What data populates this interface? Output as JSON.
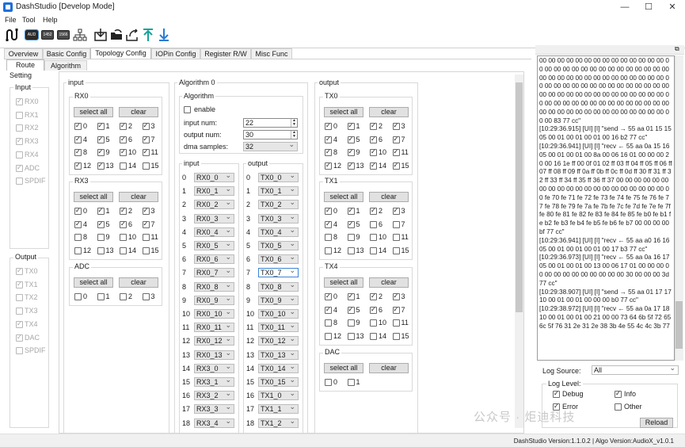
{
  "window": {
    "title": "DashStudio [Develop Mode]",
    "minimize": "—",
    "maximize": "☐",
    "close": "✕"
  },
  "menu": [
    "File",
    "Tool",
    "Help"
  ],
  "toolbar": {
    "chip1": "AUD",
    "chip2": "1452",
    "chip3": "1566"
  },
  "tabs": [
    "Overview",
    "Basic Config",
    "Topology Config",
    "IOPin Config",
    "Register R/W",
    "Misc Func"
  ],
  "subtabs": [
    "Route",
    "Algorithm"
  ],
  "setting": {
    "title": "Setting",
    "input_title": "Input",
    "inputs": [
      {
        "label": "RX0",
        "checked": true
      },
      {
        "label": "RX1",
        "checked": false
      },
      {
        "label": "RX2",
        "checked": false
      },
      {
        "label": "RX3",
        "checked": true
      },
      {
        "label": "RX4",
        "checked": false
      },
      {
        "label": "ADC",
        "checked": true
      },
      {
        "label": "SPDIF",
        "checked": false
      }
    ],
    "output_title": "Output",
    "outputs": [
      {
        "label": "TX0",
        "checked": true
      },
      {
        "label": "TX1",
        "checked": true
      },
      {
        "label": "TX2",
        "checked": false
      },
      {
        "label": "TX3",
        "checked": false
      },
      {
        "label": "TX4",
        "checked": true
      },
      {
        "label": "DAC",
        "checked": true
      },
      {
        "label": "SPDIF",
        "checked": false
      }
    ]
  },
  "input_panel": {
    "title": "input",
    "select_all": "select all",
    "clear": "clear",
    "groups": [
      {
        "name": "RX0",
        "channels": [
          "0",
          "1",
          "2",
          "3",
          "4",
          "5",
          "6",
          "7",
          "8",
          "9",
          "10",
          "11",
          "12",
          "13",
          "14",
          "15"
        ],
        "checked": [
          true,
          true,
          true,
          true,
          true,
          true,
          true,
          true,
          true,
          true,
          true,
          true,
          true,
          true,
          false,
          false
        ]
      },
      {
        "name": "RX3",
        "channels": [
          "0",
          "1",
          "2",
          "3",
          "4",
          "5",
          "6",
          "7",
          "8",
          "9",
          "10",
          "11",
          "12",
          "13",
          "14",
          "15"
        ],
        "checked": [
          true,
          true,
          true,
          true,
          true,
          true,
          true,
          true,
          false,
          false,
          false,
          false,
          false,
          false,
          false,
          false
        ]
      },
      {
        "name": "ADC",
        "channels": [
          "0",
          "1",
          "2",
          "3"
        ],
        "checked": [
          false,
          false,
          false,
          false
        ]
      }
    ]
  },
  "algorithm": {
    "title": "Algorithm 0",
    "sub_title": "Algorithm",
    "enable_label": "enable",
    "enable": false,
    "input_num_label": "input num:",
    "input_num": "22",
    "output_num_label": "output num:",
    "output_num": "30",
    "dma_label": "dma samples:",
    "dma_samples": "32",
    "input_col": "input",
    "output_col": "output",
    "rows": [
      {
        "idx": "0",
        "in": "RX0_0",
        "out": "TX0_0"
      },
      {
        "idx": "1",
        "in": "RX0_1",
        "out": "TX0_1"
      },
      {
        "idx": "2",
        "in": "RX0_2",
        "out": "TX0_2"
      },
      {
        "idx": "3",
        "in": "RX0_3",
        "out": "TX0_3"
      },
      {
        "idx": "4",
        "in": "RX0_4",
        "out": "TX0_4"
      },
      {
        "idx": "5",
        "in": "RX0_5",
        "out": "TX0_5"
      },
      {
        "idx": "6",
        "in": "RX0_6",
        "out": "TX0_6"
      },
      {
        "idx": "7",
        "in": "RX0_7",
        "out": "TX0_7"
      },
      {
        "idx": "8",
        "in": "RX0_8",
        "out": "TX0_8"
      },
      {
        "idx": "9",
        "in": "RX0_9",
        "out": "TX0_9"
      },
      {
        "idx": "10",
        "in": "RX0_10",
        "out": "TX0_10"
      },
      {
        "idx": "11",
        "in": "RX0_11",
        "out": "TX0_11"
      },
      {
        "idx": "12",
        "in": "RX0_12",
        "out": "TX0_12"
      },
      {
        "idx": "13",
        "in": "RX0_13",
        "out": "TX0_13"
      },
      {
        "idx": "14",
        "in": "RX3_0",
        "out": "TX0_14"
      },
      {
        "idx": "15",
        "in": "RX3_1",
        "out": "TX0_15"
      },
      {
        "idx": "16",
        "in": "RX3_2",
        "out": "TX1_0"
      },
      {
        "idx": "17",
        "in": "RX3_3",
        "out": "TX1_1"
      },
      {
        "idx": "18",
        "in": "RX3_4",
        "out": "TX1_2"
      }
    ]
  },
  "output_panel": {
    "title": "output",
    "select_all": "select all",
    "clear": "clear",
    "groups": [
      {
        "name": "TX0",
        "channels": [
          "0",
          "1",
          "2",
          "3",
          "4",
          "5",
          "6",
          "7",
          "8",
          "9",
          "10",
          "11",
          "12",
          "13",
          "14",
          "15"
        ],
        "checked": [
          true,
          true,
          true,
          true,
          true,
          true,
          true,
          true,
          true,
          true,
          true,
          true,
          true,
          true,
          true,
          true
        ]
      },
      {
        "name": "TX1",
        "channels": [
          "0",
          "1",
          "2",
          "3",
          "4",
          "5",
          "6",
          "7",
          "8",
          "9",
          "10",
          "11",
          "12",
          "13",
          "14",
          "15"
        ],
        "checked": [
          true,
          true,
          true,
          true,
          true,
          true,
          false,
          false,
          false,
          false,
          false,
          false,
          false,
          false,
          false,
          false
        ]
      },
      {
        "name": "TX4",
        "channels": [
          "0",
          "1",
          "2",
          "3",
          "4",
          "5",
          "6",
          "7",
          "8",
          "9",
          "10",
          "11",
          "12",
          "13",
          "14",
          "15"
        ],
        "checked": [
          true,
          true,
          true,
          true,
          true,
          true,
          true,
          true,
          false,
          false,
          false,
          false,
          false,
          false,
          false,
          false
        ]
      },
      {
        "name": "DAC",
        "channels": [
          "0",
          "1"
        ],
        "checked": [
          false,
          false
        ]
      }
    ]
  },
  "log": {
    "lines": [
      "00 00 00 00 00 00 00 00 00 00 00 00 00 00 00 00 00 00 00 00 00 00 00 00 00 00 00 00 00 00 00 00 00 00 00 00 00 00 00 00 00 00 00 00 00 00 00 00 00 00 00 00 00 00 00 00 00 00 00 00 00 00 00 00 00 00 00 00 00 00 00 00 00 00 00 00 00 00 00 00 00 00 00 00 00 00 00 00 00 00 00 00 00 00 00 00 00 00 00 00 00 00 00 83 77 cc\"",
      "[10:29:36.915] [UI] [I] \"send → 55 aa 01 15 15 05 00 01 00 01 00 01 00 16 b2 77 cc\"",
      "[10:29:36.941] [UI] [I] \"recv ← 55 aa 0a 15 16 05 00 01 00 01 00 8a 00 06 16 01 00 00 00 20 00 16 1e ff 00 0f 01 02 ff 03 ff 04 ff 05 ff 06 ff 07 ff 08 ff 09 ff 0a ff 0b ff 0c ff 0d ff 30 ff 31 ff 32 ff 33 ff 34 ff 35 ff 36 ff 37 00 00 00 00 00 00 00 00 00 00 00 00 00 00 00 00 00 00 00 00 00 fe 70 fe 71 fe 72 fe 73 fe 74 fe 75 fe 76 fe 77 fe 78 fe 79 fe 7a fe 7b fe 7c fe 7d fe 7e fe 7f fe 80 fe 81 fe 82 fe 83 fe 84 fe 85 fe b0 fe b1 fe b2 fe b3 fe b4 fe b5 fe b6 fe b7 00 00 00 00 bf 77 cc\"",
      "[10:29:36.941] [UI] [I] \"recv ← 55 aa a0 16 16 05 00 01 00 01 00 01 00 17 b3 77 cc\"",
      "[10:29:36.973] [UI] [I] \"recv ← 55 aa 0a 16 17 05 00 01 00 01 00 13 00 06 17 01 00 00 00 00 00 00 00 00 00 00 00 00 00 30 00 00 00 3d 77 cc\"",
      "[10:29:38.907] [UI] [I] \"send → 55 aa 01 17 17 10 00 01 00 01 00 00 00 b0 77 cc\"",
      "[10:29:38.972] [UI] [I] \"recv ← 55 aa 0a 17 18 10 00 01 00 01 00 21 00 00 73 64 6b 5f 72 65 6c 5f 76 31 2e 31 2e 38 3b 4e 55 4c 4c 3b 77"
    ],
    "source_label": "Log Source:",
    "source_value": "All",
    "level_label": "Log Level:",
    "levels": [
      {
        "label": "Debug",
        "checked": true
      },
      {
        "label": "Info",
        "checked": true
      },
      {
        "label": "Error",
        "checked": true
      },
      {
        "label": "Other",
        "checked": false
      }
    ],
    "reload": "Reload"
  },
  "status": "DashStudio Version:1.1.0.2 | Algo Version:AudioX_v1.0.1",
  "watermark": "公众号 · 炬迪科技"
}
